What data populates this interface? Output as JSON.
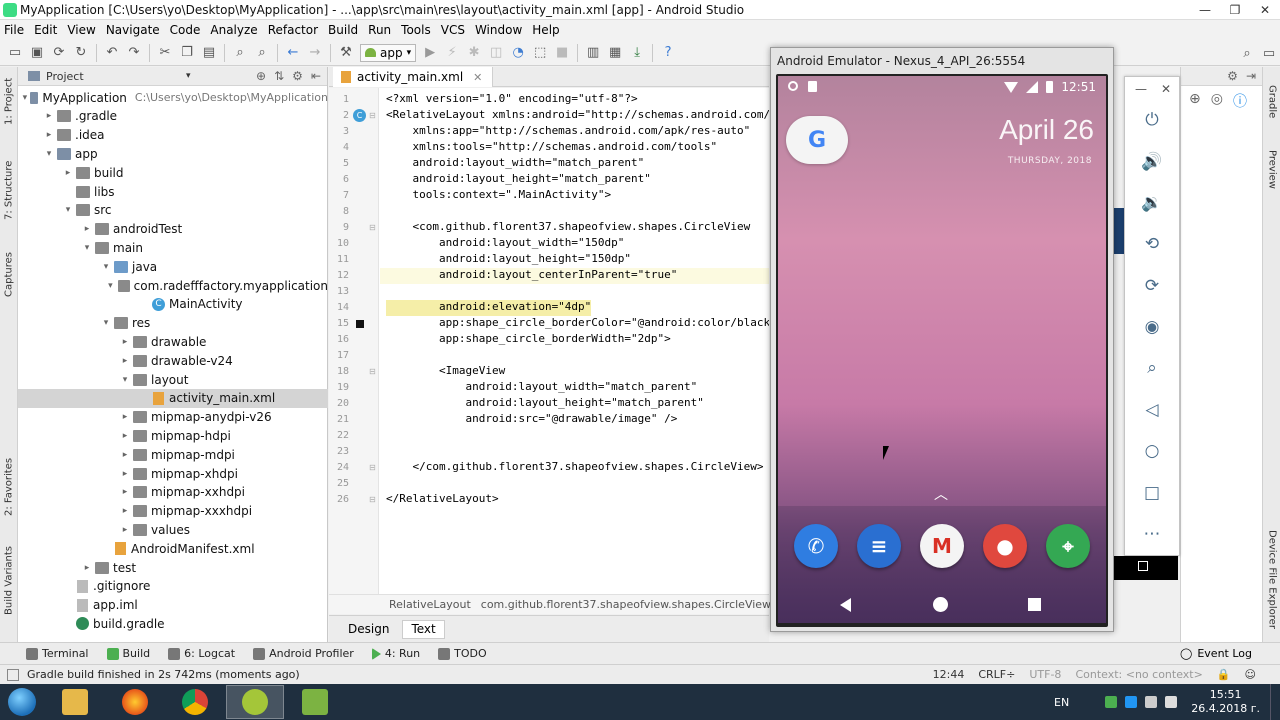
{
  "window": {
    "title": "MyApplication [C:\\Users\\yo\\Desktop\\MyApplication] - ...\\app\\src\\main\\res\\layout\\activity_main.xml [app] - Android Studio",
    "minimize": "—",
    "maximize": "❐",
    "close": "✕"
  },
  "menu": [
    "File",
    "Edit",
    "View",
    "Navigate",
    "Code",
    "Analyze",
    "Refactor",
    "Build",
    "Run",
    "Tools",
    "VCS",
    "Window",
    "Help"
  ],
  "toolbar": {
    "run_config": "app"
  },
  "left_strip": {
    "project": "1: Project",
    "structure": "7: Structure",
    "captures": "Captures",
    "favorites": "2: Favorites",
    "build_variants": "Build Variants"
  },
  "right_strip": {
    "gradle": "Gradle",
    "preview": "Preview",
    "device_file_explorer": "Device File Explorer"
  },
  "project_panel": {
    "title": "Project",
    "tree": [
      {
        "label": "MyApplication",
        "path": "C:\\Users\\yo\\Desktop\\MyApplication",
        "depth": 0,
        "arrow": "▾",
        "icon": "folder-mod"
      },
      {
        "label": ".gradle",
        "depth": 1,
        "arrow": "▸",
        "icon": "folder"
      },
      {
        "label": ".idea",
        "depth": 1,
        "arrow": "▸",
        "icon": "folder"
      },
      {
        "label": "app",
        "depth": 1,
        "arrow": "▾",
        "icon": "folder-mod"
      },
      {
        "label": "build",
        "depth": 2,
        "arrow": "▸",
        "icon": "folder"
      },
      {
        "label": "libs",
        "depth": 2,
        "arrow": "",
        "icon": "folder"
      },
      {
        "label": "src",
        "depth": 2,
        "arrow": "▾",
        "icon": "folder"
      },
      {
        "label": "androidTest",
        "depth": 3,
        "arrow": "▸",
        "icon": "folder"
      },
      {
        "label": "main",
        "depth": 3,
        "arrow": "▾",
        "icon": "folder"
      },
      {
        "label": "java",
        "depth": 4,
        "arrow": "▾",
        "icon": "folder-blue"
      },
      {
        "label": "com.radefffactory.myapplication",
        "depth": 5,
        "arrow": "▾",
        "icon": "folder"
      },
      {
        "label": "MainActivity",
        "depth": 6,
        "arrow": "",
        "icon": "class"
      },
      {
        "label": "res",
        "depth": 4,
        "arrow": "▾",
        "icon": "folder"
      },
      {
        "label": "drawable",
        "depth": 5,
        "arrow": "▸",
        "icon": "folder"
      },
      {
        "label": "drawable-v24",
        "depth": 5,
        "arrow": "▸",
        "icon": "folder"
      },
      {
        "label": "layout",
        "depth": 5,
        "arrow": "▾",
        "icon": "folder"
      },
      {
        "label": "activity_main.xml",
        "depth": 6,
        "arrow": "",
        "icon": "xml",
        "selected": true
      },
      {
        "label": "mipmap-anydpi-v26",
        "depth": 5,
        "arrow": "▸",
        "icon": "folder"
      },
      {
        "label": "mipmap-hdpi",
        "depth": 5,
        "arrow": "▸",
        "icon": "folder"
      },
      {
        "label": "mipmap-mdpi",
        "depth": 5,
        "arrow": "▸",
        "icon": "folder"
      },
      {
        "label": "mipmap-xhdpi",
        "depth": 5,
        "arrow": "▸",
        "icon": "folder"
      },
      {
        "label": "mipmap-xxhdpi",
        "depth": 5,
        "arrow": "▸",
        "icon": "folder"
      },
      {
        "label": "mipmap-xxxhdpi",
        "depth": 5,
        "arrow": "▸",
        "icon": "folder"
      },
      {
        "label": "values",
        "depth": 5,
        "arrow": "▸",
        "icon": "folder"
      },
      {
        "label": "AndroidManifest.xml",
        "depth": 4,
        "arrow": "",
        "icon": "xml"
      },
      {
        "label": "test",
        "depth": 3,
        "arrow": "▸",
        "icon": "folder"
      },
      {
        "label": ".gitignore",
        "depth": 2,
        "arrow": "",
        "icon": "file"
      },
      {
        "label": "app.iml",
        "depth": 2,
        "arrow": "",
        "icon": "file"
      },
      {
        "label": "build.gradle",
        "depth": 2,
        "arrow": "",
        "icon": "gradle"
      }
    ]
  },
  "editor": {
    "tab": "activity_main.xml",
    "lines": [
      {
        "n": "1",
        "text": "<?xml version=\"1.0\" encoding=\"utf-8\"?>"
      },
      {
        "n": "2",
        "text": "<RelativeLayout xmlns:android=\"http://schemas.android.com/"
      },
      {
        "n": "3",
        "text": "    xmlns:app=\"http://schemas.android.com/apk/res-auto\""
      },
      {
        "n": "4",
        "text": "    xmlns:tools=\"http://schemas.android.com/tools\""
      },
      {
        "n": "5",
        "text": "    android:layout_width=\"match_parent\""
      },
      {
        "n": "6",
        "text": "    android:layout_height=\"match_parent\""
      },
      {
        "n": "7",
        "text": "    tools:context=\".MainActivity\">"
      },
      {
        "n": "8",
        "text": ""
      },
      {
        "n": "9",
        "text": "    <com.github.florent37.shapeofview.shapes.CircleView"
      },
      {
        "n": "10",
        "text": "        android:layout_width=\"150dp\""
      },
      {
        "n": "11",
        "text": "        android:layout_height=\"150dp\""
      },
      {
        "n": "12",
        "text": "        android:layout_centerInParent=\"true\""
      },
      {
        "n": "13",
        "text": ""
      },
      {
        "n": "14",
        "text": "        android:elevation=\"4dp\""
      },
      {
        "n": "15",
        "text": "        app:shape_circle_borderColor=\"@android:color/black"
      },
      {
        "n": "16",
        "text": "        app:shape_circle_borderWidth=\"2dp\">"
      },
      {
        "n": "17",
        "text": ""
      },
      {
        "n": "18",
        "text": "        <ImageView"
      },
      {
        "n": "19",
        "text": "            android:layout_width=\"match_parent\""
      },
      {
        "n": "20",
        "text": "            android:layout_height=\"match_parent\""
      },
      {
        "n": "21",
        "text": "            android:src=\"@drawable/image\" />"
      },
      {
        "n": "22",
        "text": ""
      },
      {
        "n": "23",
        "text": ""
      },
      {
        "n": "24",
        "text": "    </com.github.florent37.shapeofview.shapes.CircleView>"
      },
      {
        "n": "25",
        "text": ""
      },
      {
        "n": "26",
        "text": "</RelativeLayout>"
      }
    ],
    "gutter_class_mark": "C",
    "breadcrumb": [
      "RelativeLayout",
      "com.github.florent37.shapeofview.shapes.CircleView"
    ],
    "design_tab": "Design",
    "text_tab": "Text"
  },
  "bottom_tools": [
    "Terminal",
    "Build",
    "6: Logcat",
    "Android Profiler",
    "4: Run",
    "TODO"
  ],
  "event_log": "Event Log",
  "status": {
    "message": "Gradle build finished in 2s 742ms (moments ago)",
    "position": "12:44",
    "line_sep": "CRLF÷",
    "encoding": "UTF-8",
    "context": "Context: <no context>"
  },
  "emulator": {
    "title": "Android Emulator - Nexus_4_API_26:5554",
    "time": "12:51",
    "date": "April 26",
    "weekday": "THURSDAY, 2018",
    "google": "G",
    "dock_apps": [
      {
        "name": "phone",
        "glyph": "✆",
        "color": "#2f7de1"
      },
      {
        "name": "messages",
        "glyph": "≡",
        "color": "#2a6fd1"
      },
      {
        "name": "gmail",
        "glyph": "M",
        "color": "#f4f4f4"
      },
      {
        "name": "chrome",
        "glyph": "●",
        "color": "#e0483e"
      },
      {
        "name": "maps",
        "glyph": "⌖",
        "color": "#34a853"
      }
    ],
    "side_controls": [
      "power",
      "volume-up",
      "volume-down",
      "rotate-left",
      "rotate-right",
      "screenshot",
      "zoom",
      "back",
      "home",
      "overview",
      "more"
    ]
  },
  "taskbar": {
    "lang": "EN",
    "time": "15:51",
    "date": "26.4.2018 г."
  }
}
